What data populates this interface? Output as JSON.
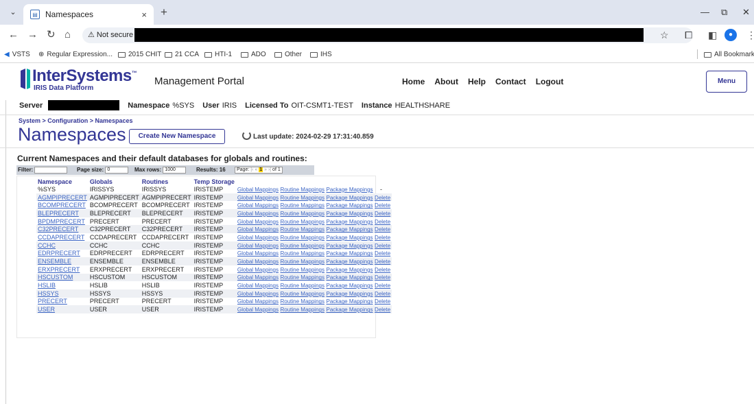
{
  "browser": {
    "tab_title": "Namespaces",
    "tab_close": "×",
    "new_tab": "+",
    "not_secure": "Not secure",
    "bookmarks": [
      "VSTS",
      "Regular Expression...",
      "2015 CHIT",
      "21 CCA",
      "HTI-1",
      "ADO",
      "Other",
      "IHS"
    ],
    "all_bookmarks": "All Bookmarks"
  },
  "portal": {
    "logo": "InterSystems",
    "logo_tm": "™",
    "logo_sub": "IRIS Data Platform",
    "title": "Management Portal",
    "nav": [
      "Home",
      "About",
      "Help",
      "Contact",
      "Logout"
    ],
    "menu": "Menu"
  },
  "info": {
    "server_label": "Server",
    "namespace_label": "Namespace",
    "namespace_value": "%SYS",
    "user_label": "User",
    "user_value": "IRIS",
    "licensed_label": "Licensed To",
    "licensed_value": "OIT-CSMT1-TEST",
    "instance_label": "Instance",
    "instance_value": "HEALTHSHARE"
  },
  "page": {
    "breadcrumb": "System > Configuration > Namespaces",
    "title": "Namespaces",
    "create_button": "Create New Namespace",
    "last_update": "Last update: 2024-02-29 17:31:40.859",
    "section_title": "Current Namespaces and their default databases for globals and routines:"
  },
  "tablebar": {
    "filter_label": "Filter:",
    "filter_value": "",
    "page_size_label": "Page size:",
    "page_size_value": "0",
    "max_rows_label": "Max rows:",
    "max_rows_value": "1000",
    "results": "Results: 16",
    "page_label": "Page:",
    "page_current": "1",
    "page_of": "of 1"
  },
  "table": {
    "headers": [
      "Namespace",
      "Globals",
      "Routines",
      "Temp Storage"
    ],
    "links": [
      "Global Mappings",
      "Routine Mappings",
      "Package Mappings",
      "Delete"
    ],
    "first_row_dash": "-",
    "rows": [
      [
        "%SYS",
        "IRISSYS",
        "IRISSYS",
        "IRISTEMP"
      ],
      [
        "AGMPIPRECERT",
        "AGMPIPRECERT",
        "AGMPIPRECERT",
        "IRISTEMP"
      ],
      [
        "BCOMPRECERT",
        "BCOMPRECERT",
        "BCOMPRECERT",
        "IRISTEMP"
      ],
      [
        "BLEPRECERT",
        "BLEPRECERT",
        "BLEPRECERT",
        "IRISTEMP"
      ],
      [
        "BPDMPRECERT",
        "PRECERT",
        "PRECERT",
        "IRISTEMP"
      ],
      [
        "C32PRECERT",
        "C32PRECERT",
        "C32PRECERT",
        "IRISTEMP"
      ],
      [
        "CCDAPRECERT",
        "CCDAPRECERT",
        "CCDAPRECERT",
        "IRISTEMP"
      ],
      [
        "CCHC",
        "CCHC",
        "CCHC",
        "IRISTEMP"
      ],
      [
        "EDRPRECERT",
        "EDRPRECERT",
        "EDRPRECERT",
        "IRISTEMP"
      ],
      [
        "ENSEMBLE",
        "ENSEMBLE",
        "ENSEMBLE",
        "IRISTEMP"
      ],
      [
        "ERXPRECERT",
        "ERXPRECERT",
        "ERXPRECERT",
        "IRISTEMP"
      ],
      [
        "HSCUSTOM",
        "HSCUSTOM",
        "HSCUSTOM",
        "IRISTEMP"
      ],
      [
        "HSLIB",
        "HSLIB",
        "HSLIB",
        "IRISTEMP"
      ],
      [
        "HSSYS",
        "HSSYS",
        "HSSYS",
        "IRISTEMP"
      ],
      [
        "PRECERT",
        "PRECERT",
        "PRECERT",
        "IRISTEMP"
      ],
      [
        "USER",
        "USER",
        "USER",
        "IRISTEMP"
      ]
    ]
  }
}
